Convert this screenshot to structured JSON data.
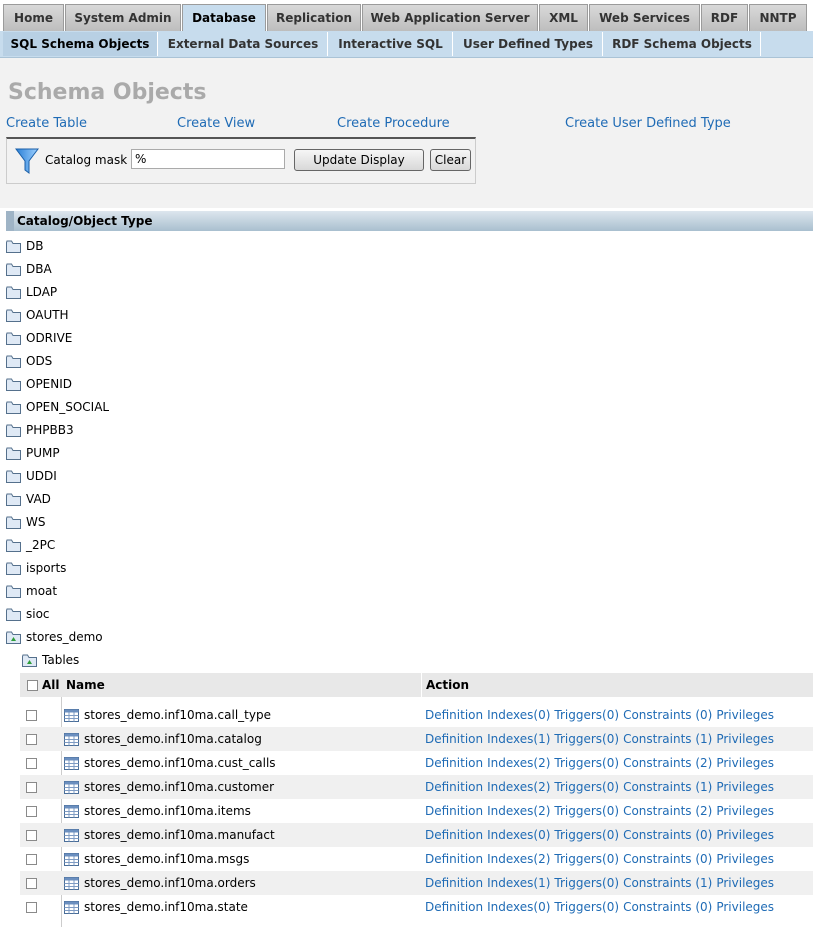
{
  "tabs_primary": [
    {
      "label": "Home"
    },
    {
      "label": "System Admin"
    },
    {
      "label": "Database"
    },
    {
      "label": "Replication"
    },
    {
      "label": "Web Application Server"
    },
    {
      "label": "XML"
    },
    {
      "label": "Web Services"
    },
    {
      "label": "RDF"
    },
    {
      "label": "NNTP"
    }
  ],
  "tabs_secondary": [
    {
      "label": "SQL Schema Objects"
    },
    {
      "label": "External Data Sources"
    },
    {
      "label": "Interactive SQL"
    },
    {
      "label": "User Defined Types"
    },
    {
      "label": "RDF Schema Objects"
    }
  ],
  "page": {
    "title": "Schema Objects",
    "links": {
      "create_table": "Create Table",
      "create_view": "Create View",
      "create_procedure": "Create Procedure",
      "create_udt": "Create User Defined Type"
    }
  },
  "filter": {
    "label": "Catalog mask",
    "value": "%",
    "update_label": "Update Display",
    "clear_label": "Clear"
  },
  "tree": {
    "header": "Catalog/Object Type",
    "catalogs": [
      {
        "label": "DB"
      },
      {
        "label": "DBA"
      },
      {
        "label": "LDAP"
      },
      {
        "label": "OAUTH"
      },
      {
        "label": "ODRIVE"
      },
      {
        "label": "ODS"
      },
      {
        "label": "OPENID"
      },
      {
        "label": "OPEN_SOCIAL"
      },
      {
        "label": "PHPBB3"
      },
      {
        "label": "PUMP"
      },
      {
        "label": "UDDI"
      },
      {
        "label": "VAD"
      },
      {
        "label": "WS"
      },
      {
        "label": "_2PC"
      },
      {
        "label": "isports"
      },
      {
        "label": "moat"
      },
      {
        "label": "sioc"
      },
      {
        "label": "stores_demo"
      }
    ],
    "sub_label": "Tables"
  },
  "table": {
    "col_all": "All",
    "col_name": "Name",
    "col_action": "Action",
    "rows": [
      {
        "name": "stores_demo.inf10ma.call_type",
        "definition": "Definition",
        "indexes": "Indexes(0)",
        "triggers": "Triggers(0)",
        "constraints": "Constraints (0)",
        "privileges": "Privileges"
      },
      {
        "name": "stores_demo.inf10ma.catalog",
        "definition": "Definition",
        "indexes": "Indexes(1)",
        "triggers": "Triggers(0)",
        "constraints": "Constraints (1)",
        "privileges": "Privileges"
      },
      {
        "name": "stores_demo.inf10ma.cust_calls",
        "definition": "Definition",
        "indexes": "Indexes(2)",
        "triggers": "Triggers(0)",
        "constraints": "Constraints (2)",
        "privileges": "Privileges"
      },
      {
        "name": "stores_demo.inf10ma.customer",
        "definition": "Definition",
        "indexes": "Indexes(2)",
        "triggers": "Triggers(0)",
        "constraints": "Constraints (1)",
        "privileges": "Privileges"
      },
      {
        "name": "stores_demo.inf10ma.items",
        "definition": "Definition",
        "indexes": "Indexes(2)",
        "triggers": "Triggers(0)",
        "constraints": "Constraints (2)",
        "privileges": "Privileges"
      },
      {
        "name": "stores_demo.inf10ma.manufact",
        "definition": "Definition",
        "indexes": "Indexes(0)",
        "triggers": "Triggers(0)",
        "constraints": "Constraints (0)",
        "privileges": "Privileges"
      },
      {
        "name": "stores_demo.inf10ma.msgs",
        "definition": "Definition",
        "indexes": "Indexes(2)",
        "triggers": "Triggers(0)",
        "constraints": "Constraints (0)",
        "privileges": "Privileges"
      },
      {
        "name": "stores_demo.inf10ma.orders",
        "definition": "Definition",
        "indexes": "Indexes(1)",
        "triggers": "Triggers(0)",
        "constraints": "Constraints (1)",
        "privileges": "Privileges"
      },
      {
        "name": "stores_demo.inf10ma.state",
        "definition": "Definition",
        "indexes": "Indexes(0)",
        "triggers": "Triggers(0)",
        "constraints": "Constraints (0)",
        "privileges": "Privileges"
      }
    ]
  }
}
